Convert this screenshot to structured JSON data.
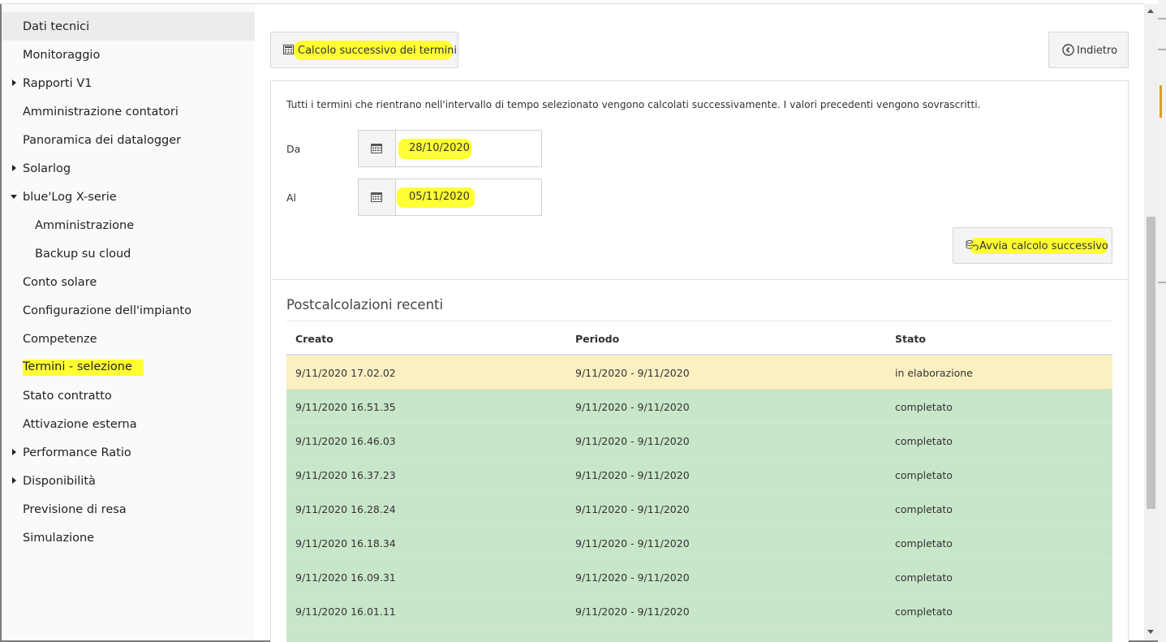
{
  "sidebar": {
    "items": [
      {
        "label": "Dati tecnici",
        "active": true,
        "caret": "none",
        "level": 0
      },
      {
        "label": "Monitoraggio",
        "caret": "none",
        "level": 0
      },
      {
        "label": "Rapporti V1",
        "caret": "right",
        "level": 0
      },
      {
        "label": "Amministrazione contatori",
        "caret": "none",
        "level": 0
      },
      {
        "label": "Panoramica dei datalogger",
        "caret": "none",
        "level": 0
      },
      {
        "label": "Solarlog",
        "caret": "right",
        "level": 0
      },
      {
        "label": "blue'Log X-serie",
        "caret": "down",
        "level": 0
      },
      {
        "label": "Amministrazione",
        "caret": "none",
        "level": 1
      },
      {
        "label": "Backup su cloud",
        "caret": "none",
        "level": 1
      },
      {
        "label": "Conto solare",
        "caret": "none",
        "level": 0
      },
      {
        "label": "Configurazione dell'impianto",
        "caret": "none",
        "level": 0
      },
      {
        "label": "Competenze",
        "caret": "none",
        "level": 0
      },
      {
        "label": "Termini - selezione",
        "caret": "none",
        "level": 0,
        "highlighted": true
      },
      {
        "label": "Stato contratto",
        "caret": "none",
        "level": 0
      },
      {
        "label": "Attivazione esterna",
        "caret": "none",
        "level": 0
      },
      {
        "label": "Performance Ratio",
        "caret": "right",
        "level": 0
      },
      {
        "label": "Disponibilità",
        "caret": "right",
        "level": 0
      },
      {
        "label": "Previsione di resa",
        "caret": "none",
        "level": 0
      },
      {
        "label": "Simulazione",
        "caret": "none",
        "level": 0
      }
    ]
  },
  "toolbar": {
    "calc_label": "Calcolo successivo dei termini",
    "calc_icon": "calculator-icon",
    "back_label": "Indietro",
    "back_icon": "circle-chevron-left-icon"
  },
  "form": {
    "description": "Tutti i termini che rientrano nell'intervallo di tempo selezionato vengono calcolati successivamente. I valori precedenti vengono sovrascritti.",
    "from_label": "Da",
    "from_value": "28/10/2020",
    "to_label": "Al",
    "to_value": "05/11/2020",
    "calendar_icon": "calendar-icon",
    "run_label": "Avvia calcolo successivo",
    "run_icon": "database-refresh-icon"
  },
  "recent": {
    "title": "Postcalcolazioni recenti",
    "columns": [
      "Creato",
      "Periodo",
      "Stato"
    ],
    "rows": [
      {
        "created": "9/11/2020 17.02.02",
        "period": "9/11/2020 - 9/11/2020",
        "status": "in elaborazione",
        "kind": "proc"
      },
      {
        "created": "9/11/2020 16.51.35",
        "period": "9/11/2020 - 9/11/2020",
        "status": "completato",
        "kind": "done"
      },
      {
        "created": "9/11/2020 16.46.03",
        "period": "9/11/2020 - 9/11/2020",
        "status": "completato",
        "kind": "done"
      },
      {
        "created": "9/11/2020 16.37.23",
        "period": "9/11/2020 - 9/11/2020",
        "status": "completato",
        "kind": "done"
      },
      {
        "created": "9/11/2020 16.28.24",
        "period": "9/11/2020 - 9/11/2020",
        "status": "completato",
        "kind": "done"
      },
      {
        "created": "9/11/2020 16.18.34",
        "period": "9/11/2020 - 9/11/2020",
        "status": "completato",
        "kind": "done"
      },
      {
        "created": "9/11/2020 16.09.31",
        "period": "9/11/2020 - 9/11/2020",
        "status": "completato",
        "kind": "done"
      },
      {
        "created": "9/11/2020 16.01.11",
        "period": "9/11/2020 - 9/11/2020",
        "status": "completato",
        "kind": "done"
      },
      {
        "created": "",
        "period": "",
        "status": "",
        "kind": "done"
      }
    ]
  },
  "colors": {
    "highlight": "#ffff33",
    "row_processing": "#fcf0c2",
    "row_done": "#c8e6c9"
  }
}
